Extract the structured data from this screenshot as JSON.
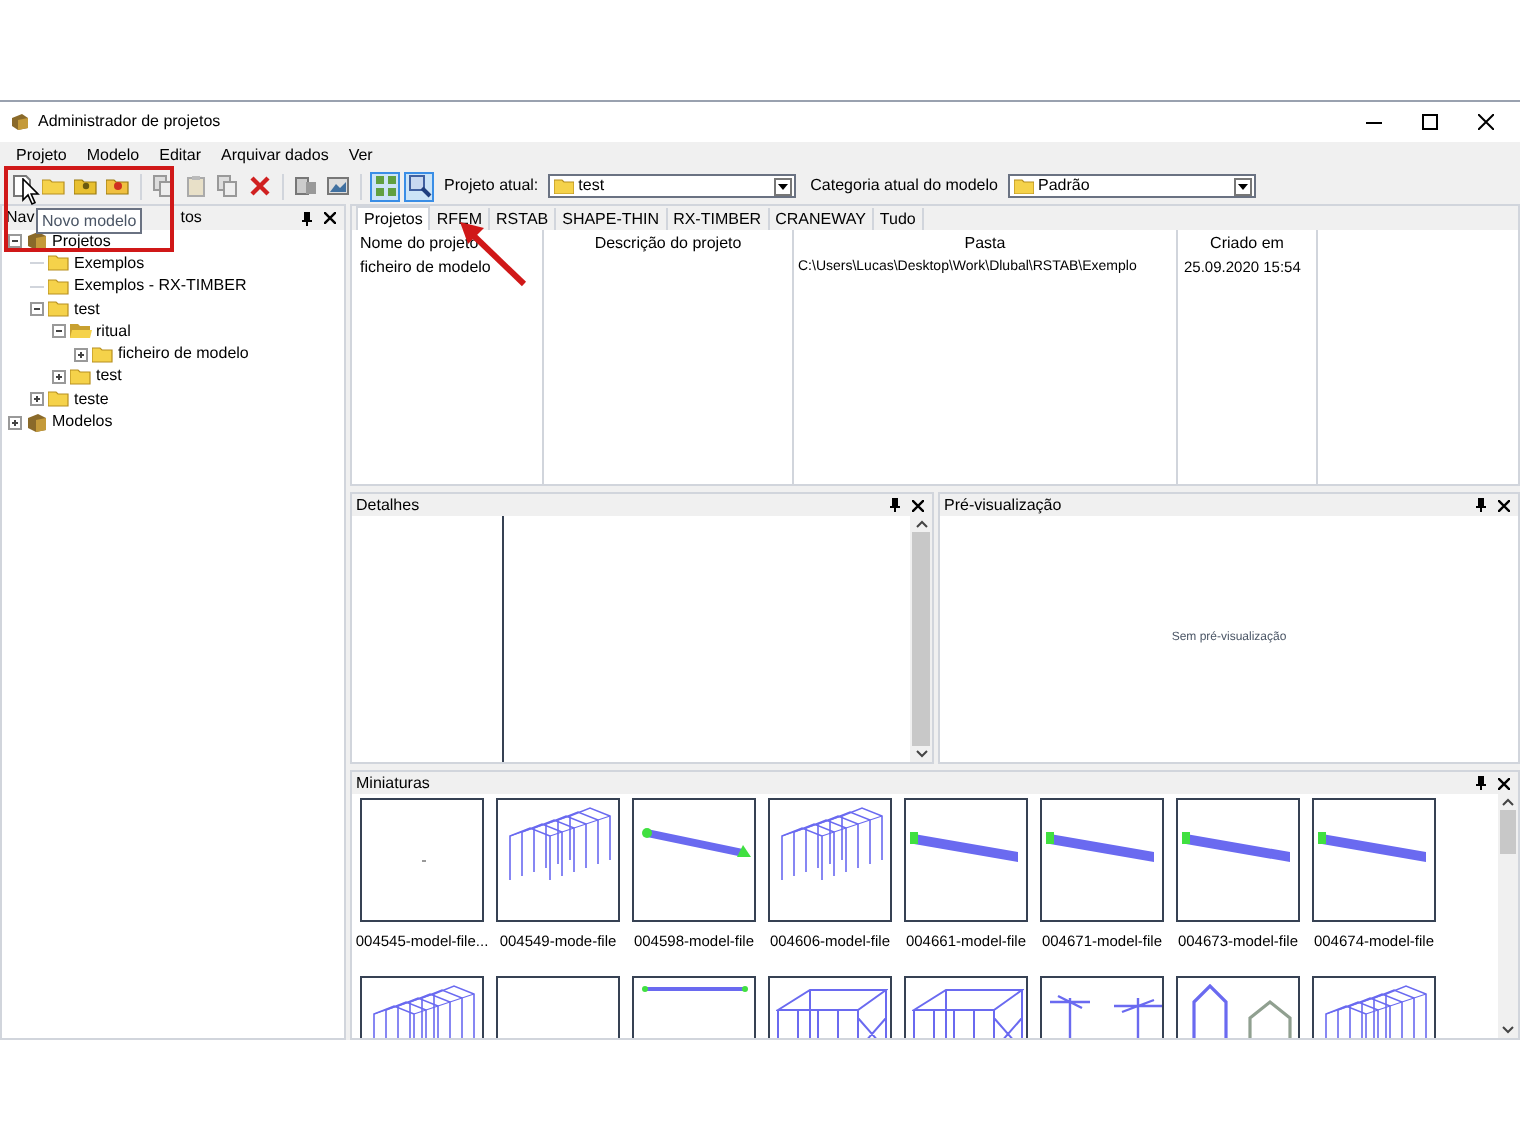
{
  "window": {
    "title": "Administrador de projetos"
  },
  "menu": [
    "Projeto",
    "Modelo",
    "Editar",
    "Arquivar dados",
    "Ver"
  ],
  "toolbar": {
    "buttons": [
      {
        "kind": "new",
        "selected": false
      },
      {
        "kind": "folder",
        "selected": false
      },
      {
        "kind": "folder-star",
        "selected": false
      },
      {
        "kind": "folder-red",
        "selected": false
      },
      {
        "kind": "sep"
      },
      {
        "kind": "copy",
        "selected": false
      },
      {
        "kind": "paste",
        "selected": false
      },
      {
        "kind": "copy",
        "selected": false
      },
      {
        "kind": "delete",
        "selected": false
      },
      {
        "kind": "sep"
      },
      {
        "kind": "export",
        "selected": false
      },
      {
        "kind": "image",
        "selected": false
      },
      {
        "kind": "sep"
      },
      {
        "kind": "grid",
        "selected": true
      },
      {
        "kind": "zoom",
        "selected": true
      }
    ],
    "project_label": "Projeto atual:",
    "project_value": "test",
    "category_label": "Categoria atual do modelo",
    "category_value": "Padrão"
  },
  "tooltip": "Novo modelo",
  "navigator": {
    "title_start": "Nav",
    "title_end": "tos",
    "tree": [
      {
        "label": "Projetos",
        "kind": "box",
        "expanded": true,
        "children": [
          {
            "label": "Exemplos",
            "kind": "folder"
          },
          {
            "label": "Exemplos - RX-TIMBER",
            "kind": "folder"
          },
          {
            "label": "test",
            "kind": "folder",
            "expanded": true,
            "children": [
              {
                "label": "ritual",
                "kind": "open-folder",
                "expanded": true,
                "children": [
                  {
                    "label": "ficheiro de modelo",
                    "kind": "folder",
                    "expanded": false
                  }
                ]
              },
              {
                "label": "test",
                "kind": "folder",
                "expanded": false
              }
            ]
          },
          {
            "label": "teste",
            "kind": "folder",
            "expanded": false
          }
        ]
      },
      {
        "label": "Modelos",
        "kind": "box",
        "expanded": false
      }
    ]
  },
  "tabs": [
    {
      "label": "Projetos",
      "selected": true
    },
    {
      "label": "RFEM",
      "selected": false
    },
    {
      "label": "RSTAB",
      "selected": false
    },
    {
      "label": "SHAPE-THIN",
      "selected": false
    },
    {
      "label": "RX-TIMBER",
      "selected": false
    },
    {
      "label": "CRANEWAY",
      "selected": false
    },
    {
      "label": "Tudo",
      "selected": false
    }
  ],
  "table": {
    "columns": [
      "Nome do projeto",
      "Descrição do projeto",
      "Pasta",
      "Criado em"
    ],
    "rows": [
      [
        "ficheiro de modelo",
        "",
        "C:\\Users\\Lucas\\Desktop\\Work\\Dlubal\\RSTAB\\Exemplo",
        "25.09.2020 15:54"
      ]
    ]
  },
  "details": {
    "title": "Detalhes"
  },
  "preview": {
    "title": "Pré-visualização",
    "empty_text": "Sem pré-visualização"
  },
  "thumbnails": {
    "title": "Miniaturas",
    "rows": [
      [
        {
          "kind": "empty",
          "label": "004545-model-file..."
        },
        {
          "kind": "hall",
          "label": "004549-mode-file"
        },
        {
          "kind": "beam2",
          "label": "004598-model-file"
        },
        {
          "kind": "hall",
          "label": "004606-model-file"
        },
        {
          "kind": "beam",
          "label": "004661-model-file"
        },
        {
          "kind": "beam",
          "label": "004671-model-file"
        },
        {
          "kind": "beam",
          "label": "004673-model-file"
        },
        {
          "kind": "beam",
          "label": "004674-model-file"
        }
      ],
      [
        {
          "kind": "hall"
        },
        {
          "kind": "blank"
        },
        {
          "kind": "flat"
        },
        {
          "kind": "truss"
        },
        {
          "kind": "truss"
        },
        {
          "kind": "tees"
        },
        {
          "kind": "gables"
        },
        {
          "kind": "hall"
        }
      ]
    ]
  }
}
